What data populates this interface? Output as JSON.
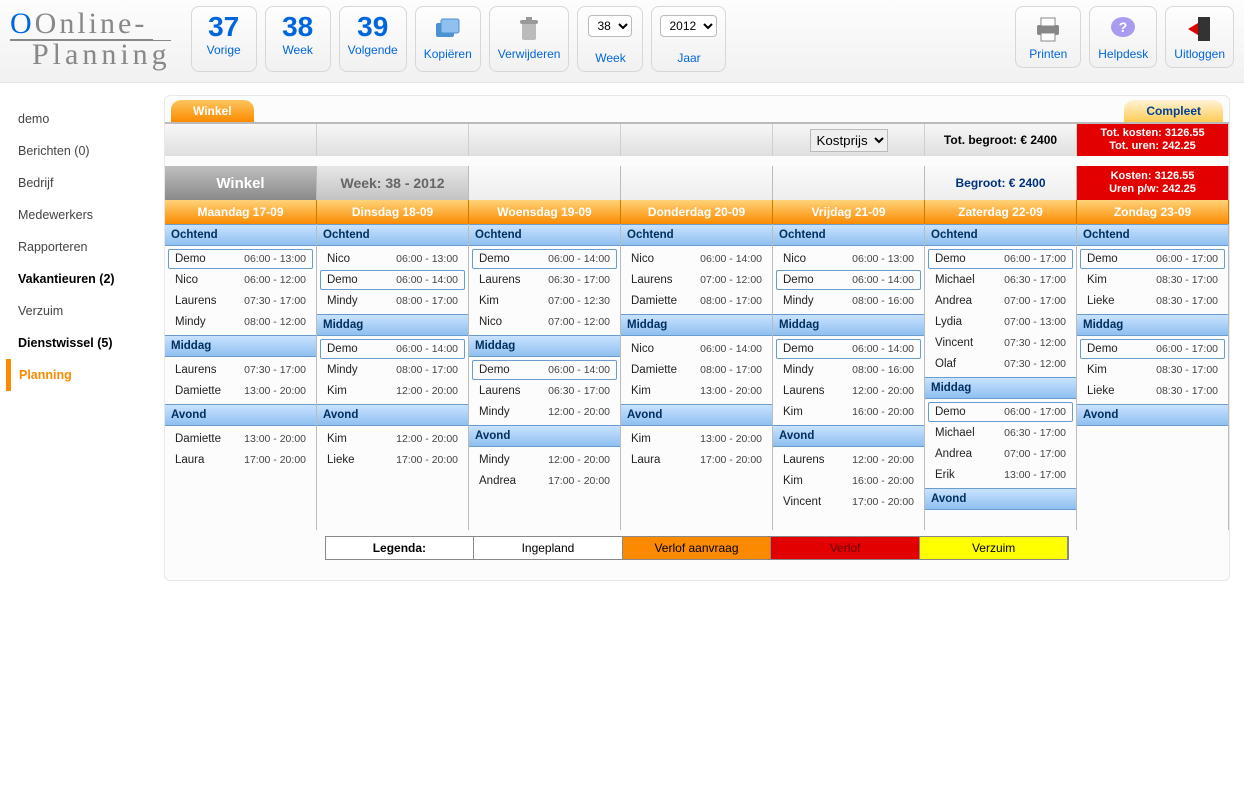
{
  "app": {
    "logo1": "Online-",
    "logo2": "Planning"
  },
  "toolbar": {
    "prev": {
      "num": "37",
      "label": "Vorige"
    },
    "week": {
      "num": "38",
      "label": "Week"
    },
    "next": {
      "num": "39",
      "label": "Volgende"
    },
    "copy": {
      "label": "Kopiëren"
    },
    "delete": {
      "label": "Verwijderen"
    },
    "weeksel": {
      "value": "38",
      "label": "Week"
    },
    "yearsel": {
      "value": "2012",
      "label": "Jaar"
    },
    "print": {
      "label": "Printen"
    },
    "help": {
      "label": "Helpdesk"
    },
    "logout": {
      "label": "Uitloggen"
    }
  },
  "sidebar": {
    "items": [
      {
        "label": "demo"
      },
      {
        "label": "Berichten (0)"
      },
      {
        "label": "Bedrijf"
      },
      {
        "label": "Medewerkers"
      },
      {
        "label": "Rapporteren"
      },
      {
        "label": "Vakantieuren (2)",
        "bold": true
      },
      {
        "label": "Verzuim"
      },
      {
        "label": "Dienstwissel (5)",
        "bold": true
      },
      {
        "label": "Planning",
        "active": true
      }
    ]
  },
  "tabs": {
    "left": "Winkel",
    "right": "Compleet"
  },
  "subhead": {
    "kostprijs": "Kostprijs",
    "begroot": "Tot. begroot: € 2400",
    "totkosten": "Tot. kosten: 3126.55",
    "toturen": "Tot. uren: 242.25"
  },
  "weekhead": {
    "winkel": "Winkel",
    "week": "Week: 38 - 2012",
    "begroot": "Begroot: € 2400",
    "kosten": "Kosten: 3126.55",
    "uren": "Uren p/w: 242.25"
  },
  "days": [
    "Maandag 17-09",
    "Dinsdag 18-09",
    "Woensdag 19-09",
    "Donderdag 20-09",
    "Vrijdag 21-09",
    "Zaterdag 22-09",
    "Zondag 23-09"
  ],
  "periods": [
    "Ochtend",
    "Middag",
    "Avond"
  ],
  "schedule": [
    {
      "ochtend": [
        {
          "n": "Demo",
          "t": "06:00 - 13:00",
          "b": 1
        },
        {
          "n": "Nico",
          "t": "06:00 - 12:00"
        },
        {
          "n": "Laurens",
          "t": "07:30 - 17:00"
        },
        {
          "n": "Mindy",
          "t": "08:00 - 12:00"
        }
      ],
      "middag": [
        {
          "n": "Laurens",
          "t": "07:30 - 17:00"
        },
        {
          "n": "Damiette",
          "t": "13:00 - 20:00"
        }
      ],
      "avond": [
        {
          "n": "Damiette",
          "t": "13:00 - 20:00"
        },
        {
          "n": "Laura",
          "t": "17:00 - 20:00"
        }
      ]
    },
    {
      "ochtend": [
        {
          "n": "Nico",
          "t": "06:00 - 13:00"
        },
        {
          "n": "Demo",
          "t": "06:00 - 14:00",
          "b": 1
        },
        {
          "n": "Mindy",
          "t": "08:00 - 17:00"
        }
      ],
      "middag": [
        {
          "n": "Demo",
          "t": "06:00 - 14:00",
          "b": 1
        },
        {
          "n": "Mindy",
          "t": "08:00 - 17:00"
        },
        {
          "n": "Kim",
          "t": "12:00 - 20:00"
        }
      ],
      "avond": [
        {
          "n": "Kim",
          "t": "12:00 - 20:00"
        },
        {
          "n": "Lieke",
          "t": "17:00 - 20:00"
        }
      ]
    },
    {
      "ochtend": [
        {
          "n": "Demo",
          "t": "06:00 - 14:00",
          "b": 1
        },
        {
          "n": "Laurens",
          "t": "06:30 - 17:00"
        },
        {
          "n": "Kim",
          "t": "07:00 - 12:30"
        },
        {
          "n": "Nico",
          "t": "07:00 - 12:00"
        }
      ],
      "middag": [
        {
          "n": "Demo",
          "t": "06:00 - 14:00",
          "b": 1
        },
        {
          "n": "Laurens",
          "t": "06:30 - 17:00"
        },
        {
          "n": "Mindy",
          "t": "12:00 - 20:00"
        }
      ],
      "avond": [
        {
          "n": "Mindy",
          "t": "12:00 - 20:00"
        },
        {
          "n": "Andrea",
          "t": "17:00 - 20:00"
        }
      ]
    },
    {
      "ochtend": [
        {
          "n": "Nico",
          "t": "06:00 - 14:00"
        },
        {
          "n": "Laurens",
          "t": "07:00 - 12:00"
        },
        {
          "n": "Damiette",
          "t": "08:00 - 17:00"
        }
      ],
      "middag": [
        {
          "n": "Nico",
          "t": "06:00 - 14:00"
        },
        {
          "n": "Damiette",
          "t": "08:00 - 17:00"
        },
        {
          "n": "Kim",
          "t": "13:00 - 20:00"
        }
      ],
      "avond": [
        {
          "n": "Kim",
          "t": "13:00 - 20:00"
        },
        {
          "n": "Laura",
          "t": "17:00 - 20:00"
        }
      ]
    },
    {
      "ochtend": [
        {
          "n": "Nico",
          "t": "06:00 - 13:00"
        },
        {
          "n": "Demo",
          "t": "06:00 - 14:00",
          "b": 1
        },
        {
          "n": "Mindy",
          "t": "08:00 - 16:00"
        }
      ],
      "middag": [
        {
          "n": "Demo",
          "t": "06:00 - 14:00",
          "b": 1
        },
        {
          "n": "Mindy",
          "t": "08:00 - 16:00"
        },
        {
          "n": "Laurens",
          "t": "12:00 - 20:00"
        },
        {
          "n": "Kim",
          "t": "16:00 - 20:00"
        }
      ],
      "avond": [
        {
          "n": "Laurens",
          "t": "12:00 - 20:00"
        },
        {
          "n": "Kim",
          "t": "16:00 - 20:00"
        },
        {
          "n": "Vincent",
          "t": "17:00 - 20:00"
        }
      ]
    },
    {
      "ochtend": [
        {
          "n": "Demo",
          "t": "06:00 - 17:00",
          "b": 1
        },
        {
          "n": "Michael",
          "t": "06:30 - 17:00"
        },
        {
          "n": "Andrea",
          "t": "07:00 - 17:00"
        },
        {
          "n": "Lydia",
          "t": "07:00 - 13:00"
        },
        {
          "n": "Vincent",
          "t": "07:30 - 12:00"
        },
        {
          "n": "Olaf",
          "t": "07:30 - 12:00"
        }
      ],
      "middag": [
        {
          "n": "Demo",
          "t": "06:00 - 17:00",
          "b": 1
        },
        {
          "n": "Michael",
          "t": "06:30 - 17:00"
        },
        {
          "n": "Andrea",
          "t": "07:00 - 17:00"
        },
        {
          "n": "Erik",
          "t": "13:00 - 17:00"
        }
      ],
      "avond": []
    },
    {
      "ochtend": [
        {
          "n": "Demo",
          "t": "06:00 - 17:00",
          "b": 1
        },
        {
          "n": "Kim",
          "t": "08:30 - 17:00"
        },
        {
          "n": "Lieke",
          "t": "08:30 - 17:00"
        }
      ],
      "middag": [
        {
          "n": "Demo",
          "t": "06:00 - 17:00",
          "b": 1
        },
        {
          "n": "Kim",
          "t": "08:30 - 17:00"
        },
        {
          "n": "Lieke",
          "t": "08:30 - 17:00"
        }
      ],
      "avond": []
    }
  ],
  "legend": {
    "title": "Legenda:",
    "ingepland": "Ingepland",
    "verlofaanvraag": "Verlof aanvraag",
    "verlof": "Verlof",
    "verzuim": "Verzuim"
  }
}
